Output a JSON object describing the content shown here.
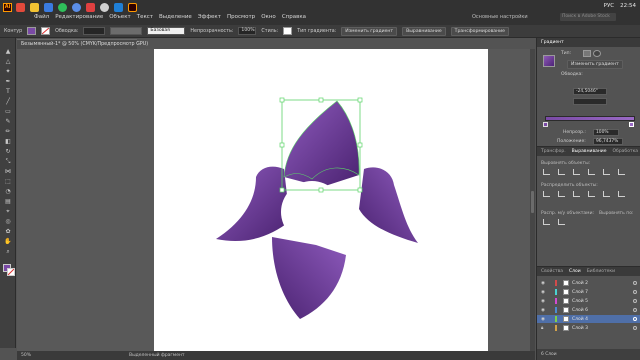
{
  "app": {
    "logo_text": "Ai",
    "menu": [
      "Файл",
      "Редактирование",
      "Объект",
      "Текст",
      "Выделение",
      "Эффект",
      "Просмотр",
      "Окно",
      "Справка"
    ],
    "workspace": "Основные настройки",
    "search_placeholder": "Поиск в Adobe Stock",
    "clock": "22:54",
    "lang": "РУС",
    "window_buttons": [
      "—",
      "❐",
      "✕"
    ]
  },
  "control_bar": {
    "selection_label": "Контур",
    "stroke_label": "Обводка:",
    "stroke_value": "",
    "brush_label": "Базовая",
    "opacity_label": "Непрозрачность:",
    "opacity_value": "100%",
    "style_label": "Стиль:",
    "grad_type_label": "Тип градиента:",
    "edit_gradient_button": "Изменить градиент",
    "align_button": "Выравнивание",
    "transform_button": "Трансформирование"
  },
  "document": {
    "tab_title": "Безымянный-1* @ 50% (CMYK/Предпросмотр GPU)",
    "zoom": "50%",
    "status_text": "Выделенный фрагмент"
  },
  "gradient_panel": {
    "title": "Градиент",
    "type_label": "Тип:",
    "edit_button": "Изменить градиент",
    "stroke_label": "Обводка:",
    "angle_value": "-24,5046°",
    "opacity_label": "Непрозр.:",
    "opacity_value": "100%",
    "location_label": "Положение:",
    "location_value": "96,7437%"
  },
  "align_panel": {
    "tabs": [
      "Трансфор.",
      "Выравнивание",
      "Обработка"
    ],
    "section_objects": "Выровнять объекты:",
    "section_distribute": "Распределить объекты:",
    "section_spacing": "Распр. м/у объектами:",
    "section_align_to": "Выровнять по:"
  },
  "layers_panel": {
    "tabs": [
      "Свойства",
      "Слои",
      "Библиотеки"
    ],
    "layers": [
      {
        "name": "Слой 2",
        "color": "#d24b4b",
        "selected": false
      },
      {
        "name": "Слой 7",
        "color": "#4bd2d2",
        "selected": false
      },
      {
        "name": "Слой 5",
        "color": "#d24bd2",
        "selected": false
      },
      {
        "name": "Слой 6",
        "color": "#4b8cd2",
        "selected": false
      },
      {
        "name": "Слой 4",
        "color": "#7fd24b",
        "selected": true
      },
      {
        "name": "Слой 3",
        "color": "#d2a24b",
        "selected": false
      }
    ],
    "footer": "6 Слои"
  },
  "colors": {
    "petal_light": "#8e5bbd",
    "petal_dark": "#4a2270",
    "selection": "#5cd36a",
    "accent_ai": "#ff9a00"
  }
}
